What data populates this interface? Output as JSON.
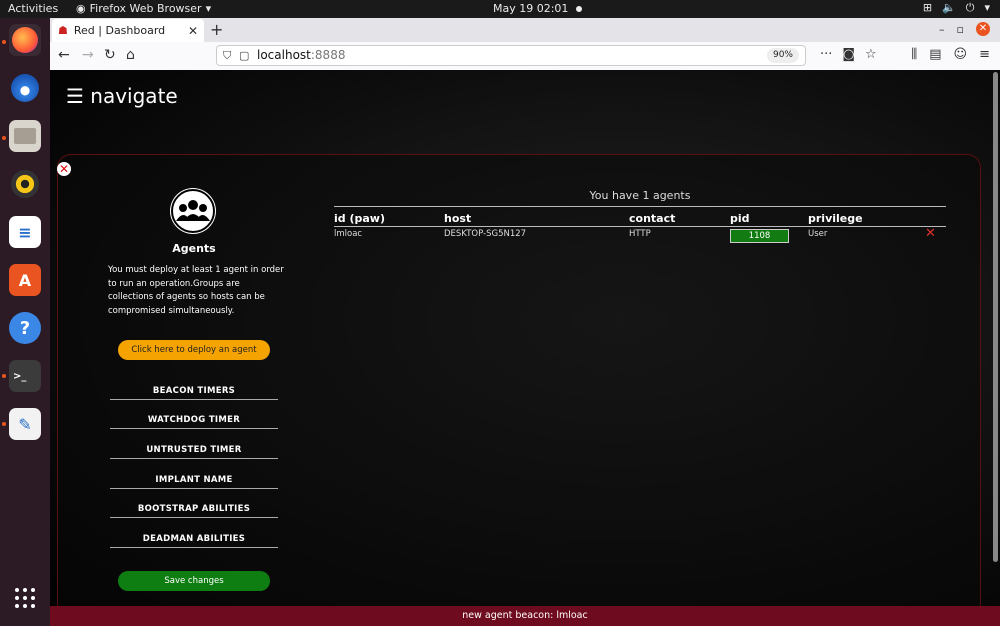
{
  "system": {
    "activities": "Activities",
    "app_name": "Firefox Web Browser",
    "clock": "May 19  02:01"
  },
  "browser": {
    "tab_title": "Red | Dashboard",
    "url_host": "localhost",
    "url_port": ":8888",
    "zoom": "90%"
  },
  "page": {
    "nav_title": "☰ navigate",
    "agents_title": "Agents",
    "description": "You must deploy at least 1 agent in order to run an operation.Groups are collections of agents so hosts can be compromised simultaneously.",
    "deploy_label": "Click here to deploy an agent",
    "sections": [
      "BEACON TIMERS",
      "WATCHDOG TIMER",
      "UNTRUSTED TIMER",
      "IMPLANT NAME",
      "BOOTSTRAP ABILITIES",
      "DEADMAN ABILITIES"
    ],
    "save_label": "Save changes",
    "agent_count": "You have 1 agents",
    "table": {
      "headers": [
        "id (paw)",
        "host",
        "contact",
        "pid",
        "privilege"
      ],
      "rows": [
        {
          "paw": "lmloac",
          "host": "DESKTOP-SG5N127",
          "contact": "HTTP",
          "pid": "1108",
          "privilege": "User"
        }
      ]
    },
    "status_bar": "new agent beacon: lmloac"
  },
  "colors": {
    "accent_deploy": "#f5a300",
    "accent_save": "#0f7e12",
    "status_bar": "#6e0b1e",
    "panel_border": "#5a1010"
  }
}
